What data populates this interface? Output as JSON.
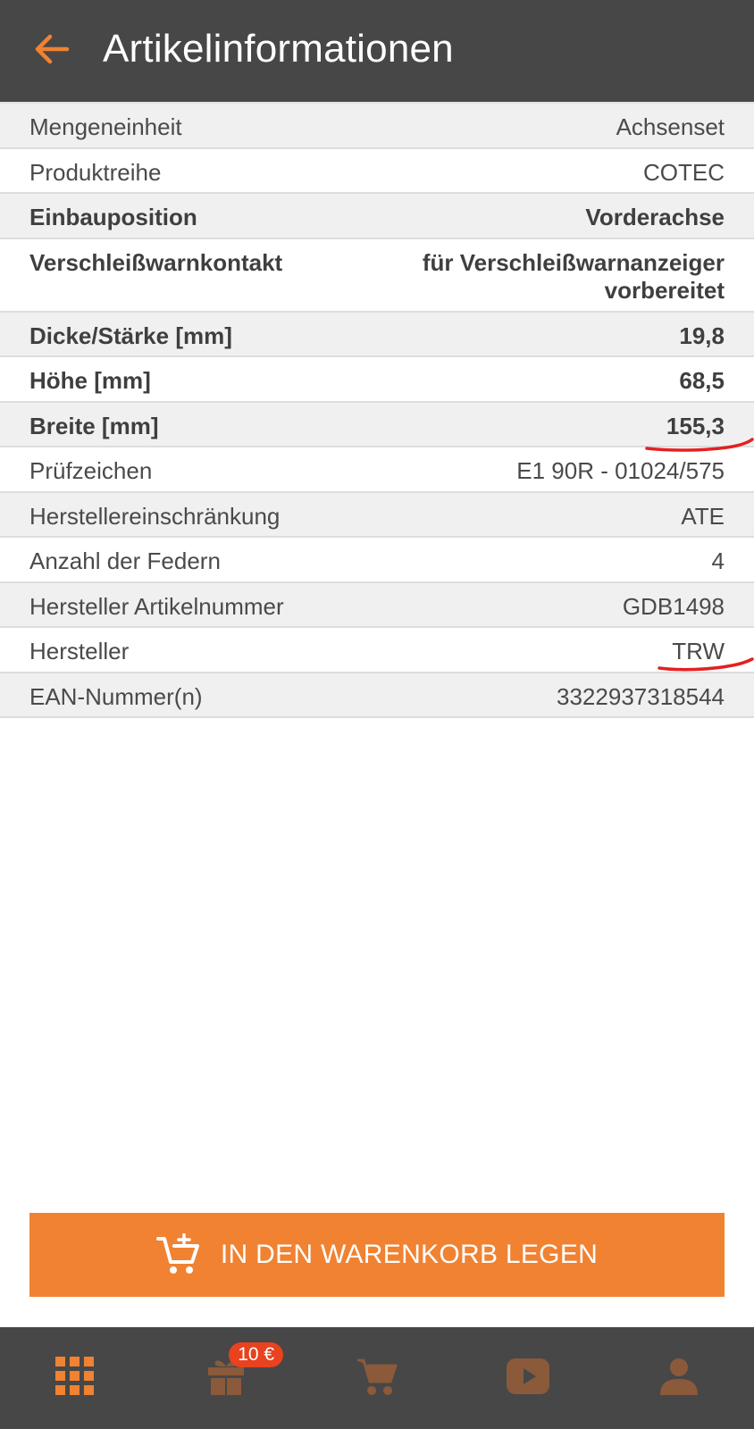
{
  "header": {
    "title": "Artikelinformationen",
    "back_icon": "arrow-left-icon",
    "accent": "#f08232",
    "background": "#474747"
  },
  "rows": [
    {
      "label": "Mengeneinheit",
      "value": "Achsenset"
    },
    {
      "label": "Produktreihe",
      "value": "COTEC"
    },
    {
      "label": "Einbauposition",
      "value": "Vorderachse"
    },
    {
      "label": "Verschleißwarnkontakt",
      "value": "für Verschleißwarnanzeiger vorbereitet"
    },
    {
      "label": "Dicke/Stärke [mm]",
      "value": "19,8"
    },
    {
      "label": "Höhe [mm]",
      "value": "68,5"
    },
    {
      "label": "Breite [mm]",
      "value": "155,3"
    },
    {
      "label": "Prüfzeichen",
      "value": "E1 90R - 01024/575"
    },
    {
      "label": "Herstellereinschränkung",
      "value": "ATE"
    },
    {
      "label": "Anzahl der Federn",
      "value": "4"
    },
    {
      "label": "Hersteller Artikelnummer",
      "value": "GDB1498"
    },
    {
      "label": "Hersteller",
      "value": "TRW"
    },
    {
      "label": "EAN-Nummer(n)",
      "value": "3322937318544"
    }
  ],
  "cart_button": {
    "label": "IN DEN WARENKORB LEGEN",
    "icon": "cart-add-icon",
    "color": "#f08232"
  },
  "bottom_nav": {
    "items": [
      {
        "icon": "grid-icon",
        "active": true
      },
      {
        "icon": "gift-icon",
        "badge": "10 €"
      },
      {
        "icon": "cart-icon"
      },
      {
        "icon": "play-icon"
      },
      {
        "icon": "person-icon"
      }
    ],
    "active_color": "#f08232",
    "inactive_color": "#8a5a3a",
    "badge_color": "#e8421f"
  },
  "annotation_color": "#e32020"
}
